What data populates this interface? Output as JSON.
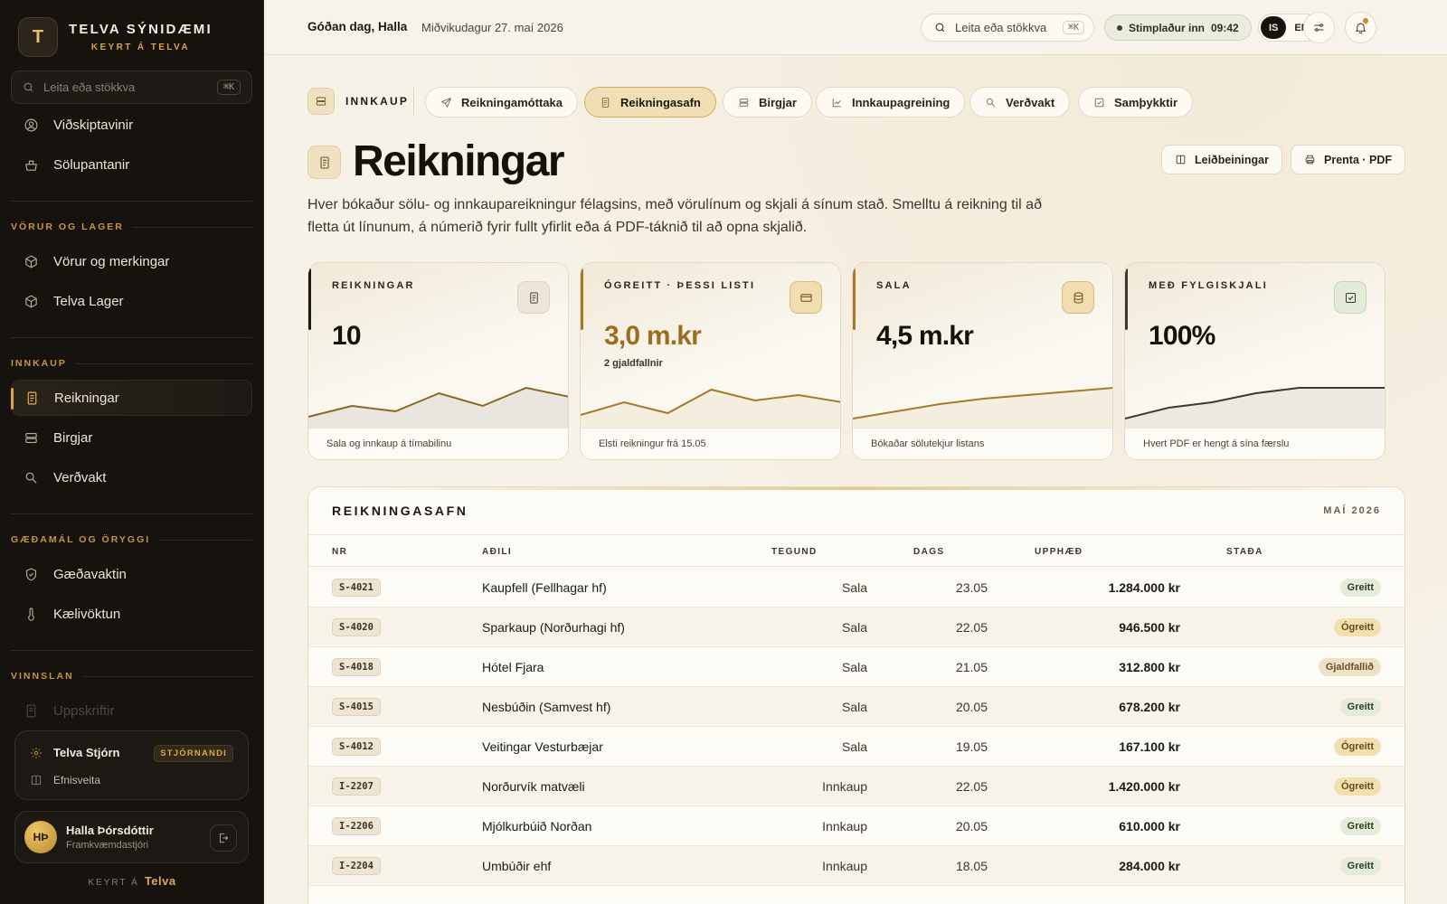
{
  "brand": {
    "logo_letter": "T",
    "name": "TELVA SÝNIDÆMI",
    "sub": "KEYRT Á TELVA"
  },
  "sidebar": {
    "search": {
      "placeholder": "Leita eða stökkva",
      "shortcut": "⌘K"
    },
    "top_items": [
      {
        "label": "Viðskiptavinir",
        "icon": "user-circle-icon"
      },
      {
        "label": "Sölupantanir",
        "icon": "basket-icon"
      }
    ],
    "sections": [
      {
        "title": "VÖRUR OG LAGER",
        "items": [
          {
            "label": "Vörur og merkingar",
            "icon": "box-icon"
          },
          {
            "label": "Telva Lager",
            "icon": "box-icon"
          }
        ]
      },
      {
        "title": "INNKAUP",
        "items": [
          {
            "label": "Reikningar",
            "icon": "receipt-icon",
            "active": true
          },
          {
            "label": "Birgjar",
            "icon": "suppliers-icon"
          },
          {
            "label": "Verðvakt",
            "icon": "search-price-icon"
          }
        ]
      },
      {
        "title": "GÆÐAMÁL OG ÖRYGGI",
        "items": [
          {
            "label": "Gæðavaktin",
            "icon": "shield-icon"
          },
          {
            "label": "Kælivöktun",
            "icon": "thermometer-icon"
          }
        ]
      },
      {
        "title": "VINNSLAN",
        "items": [
          {
            "label": "Uppskriftir",
            "icon": "recipe-icon"
          }
        ]
      }
    ],
    "admin": {
      "label": "Telva Stjórn",
      "badge": "STJÓRNANDI",
      "sub_label": "Efnisveita"
    },
    "user": {
      "initials": "HÞ",
      "name": "Halla Þórsdóttir",
      "role": "Framkvæmdastjóri"
    },
    "powered_by": {
      "prefix": "KEYRT Á",
      "name": "Telva"
    }
  },
  "topbar": {
    "greeting": "Góðan dag, Halla",
    "date": "Miðvikudagur 27. maí 2026",
    "search": {
      "placeholder": "Leita eða stökkva",
      "shortcut": "⌘K"
    },
    "stamp": {
      "label": "Stimplaður inn",
      "time": "09:42"
    },
    "languages": [
      "IS",
      "EN"
    ],
    "active_language": "IS"
  },
  "section": {
    "label": "INNKAUP",
    "tabs": [
      {
        "label": "Reikningamóttaka",
        "icon": "send-icon"
      },
      {
        "label": "Reikningasafn",
        "icon": "receipt-icon",
        "active": true
      },
      {
        "label": "Birgjar",
        "icon": "suppliers-icon"
      },
      {
        "label": "Innkaupagreining",
        "icon": "chart-icon"
      },
      {
        "label": "Verðvakt",
        "icon": "search-price-icon"
      },
      {
        "label": "Samþykktir",
        "icon": "check-square-icon"
      }
    ]
  },
  "page": {
    "title": "Reikningar",
    "description": "Hver bókaður sölu- og innkaupareikningur félagsins, með vörulínum og skjali á sínum stað. Smelltu á reikning til að fletta út línunum, á númerið fyrir fullt yfirlit eða á PDF-táknið til að opna skjalið.",
    "actions": [
      {
        "label": "Leiðbeiningar",
        "icon": "book-icon"
      },
      {
        "label": "Prenta · PDF",
        "icon": "printer-icon"
      }
    ]
  },
  "kpis": [
    {
      "label": "REIKNINGAR",
      "value": "10",
      "sub": "",
      "footer": "Sala og innkaup á tímabilinu",
      "icon": "receipt-icon",
      "accent": "#1d1a14",
      "trend": [
        0.15,
        0.45,
        0.3,
        0.8,
        0.45,
        0.95,
        0.7
      ]
    },
    {
      "label": "ÓGREITT · ÞESSI LISTI",
      "value": "3,0 m.kr",
      "sub": "2 gjaldfallnir",
      "footer": "Elsti reikningur frá 15.05",
      "icon": "card-icon",
      "accent": "#a67a23",
      "trend": [
        0.2,
        0.55,
        0.25,
        0.9,
        0.6,
        0.75,
        0.55
      ]
    },
    {
      "label": "SALA",
      "value": "4,5 m.kr",
      "sub": "",
      "footer": "Bókaðar sölutekjur listans",
      "icon": "database-icon",
      "accent": "#a67a23",
      "trend": [
        0.1,
        0.3,
        0.5,
        0.65,
        0.75,
        0.85,
        0.95
      ]
    },
    {
      "label": "MEÐ FYLGISKJALI",
      "value": "100%",
      "sub": "",
      "footer": "Hvert PDF er hengt á sína færslu",
      "icon": "check-square-icon",
      "accent": "#3a3a2e",
      "trend": [
        0.1,
        0.4,
        0.55,
        0.8,
        0.95,
        0.95,
        0.95
      ]
    }
  ],
  "table": {
    "title": "REIKNINGASAFN",
    "period": "MAÍ 2026",
    "columns": [
      "NR",
      "AÐILI",
      "TEGUND",
      "DAGS",
      "UPPHÆÐ",
      "STAÐA"
    ],
    "rows": [
      {
        "nr": "S-4021",
        "party": "Kaupfell (Fellhagar hf)",
        "type": "Sala",
        "date": "23.05",
        "amount": "1.284.000 kr",
        "status": "Greitt",
        "kind": "paid"
      },
      {
        "nr": "S-4020",
        "party": "Sparkaup (Norðurhagi hf)",
        "type": "Sala",
        "date": "22.05",
        "amount": "946.500 kr",
        "status": "Ógreitt",
        "kind": "unpaid"
      },
      {
        "nr": "S-4018",
        "party": "Hótel Fjara",
        "type": "Sala",
        "date": "21.05",
        "amount": "312.800 kr",
        "status": "Gjaldfallið",
        "kind": "due"
      },
      {
        "nr": "S-4015",
        "party": "Nesbúðin (Samvest hf)",
        "type": "Sala",
        "date": "20.05",
        "amount": "678.200 kr",
        "status": "Greitt",
        "kind": "paid"
      },
      {
        "nr": "S-4012",
        "party": "Veitingar Vesturbæjar",
        "type": "Sala",
        "date": "19.05",
        "amount": "167.100 kr",
        "status": "Ógreitt",
        "kind": "unpaid"
      },
      {
        "nr": "I-2207",
        "party": "Norðurvík matvæli",
        "type": "Innkaup",
        "date": "22.05",
        "amount": "1.420.000 kr",
        "status": "Ógreitt",
        "kind": "unpaid"
      },
      {
        "nr": "I-2206",
        "party": "Mjólkurbúið Norðan",
        "type": "Innkaup",
        "date": "20.05",
        "amount": "610.000 kr",
        "status": "Greitt",
        "kind": "paid"
      },
      {
        "nr": "I-2204",
        "party": "Umbúðir ehf",
        "type": "Innkaup",
        "date": "18.05",
        "amount": "284.000 kr",
        "status": "Greitt",
        "kind": "paid"
      }
    ]
  }
}
